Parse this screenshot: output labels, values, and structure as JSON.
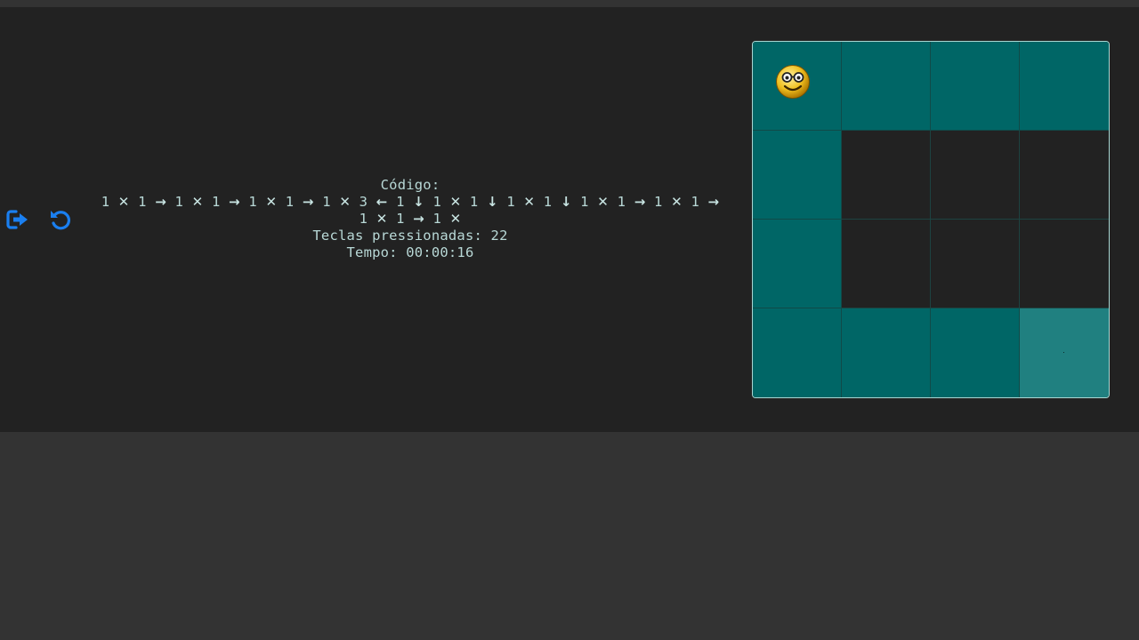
{
  "toolbar": {
    "exit_icon": "sign-out-icon",
    "restart_icon": "undo-icon",
    "accent_color": "#1a7ff0"
  },
  "info": {
    "code_label": "Código:",
    "code_sequence": [
      {
        "n": "1",
        "s": "✕"
      },
      {
        "n": "1",
        "s": "→"
      },
      {
        "n": "1",
        "s": "✕"
      },
      {
        "n": "1",
        "s": "→"
      },
      {
        "n": "1",
        "s": "✕"
      },
      {
        "n": "1",
        "s": "→"
      },
      {
        "n": "1",
        "s": "✕"
      },
      {
        "n": "3",
        "s": "←"
      },
      {
        "n": "1",
        "s": "↓"
      },
      {
        "n": "1",
        "s": "✕"
      },
      {
        "n": "1",
        "s": "↓"
      },
      {
        "n": "1",
        "s": "✕"
      },
      {
        "n": "1",
        "s": "↓"
      },
      {
        "n": "1",
        "s": "✕"
      },
      {
        "n": "1",
        "s": "→"
      },
      {
        "n": "1",
        "s": "✕"
      },
      {
        "n": "1",
        "s": "→"
      },
      {
        "n": "1",
        "s": "✕"
      },
      {
        "n": "1",
        "s": "→"
      },
      {
        "n": "1",
        "s": "✕"
      }
    ],
    "keys_label": "Teclas pressionadas: 22",
    "time_label": "Tempo: 00:00:16"
  },
  "board": {
    "rows": 4,
    "cols": 4,
    "grid": [
      [
        "path",
        "path",
        "path",
        "path"
      ],
      [
        "path",
        "wall",
        "wall",
        "wall"
      ],
      [
        "path",
        "wall",
        "wall",
        "wall"
      ],
      [
        "path",
        "path",
        "path",
        "goal"
      ]
    ],
    "player_row": 0,
    "player_col": 0,
    "player_icon": "nerd-smiley-icon",
    "colors": {
      "path": "#006666",
      "wall": "#222222",
      "goal": "#208080"
    }
  }
}
